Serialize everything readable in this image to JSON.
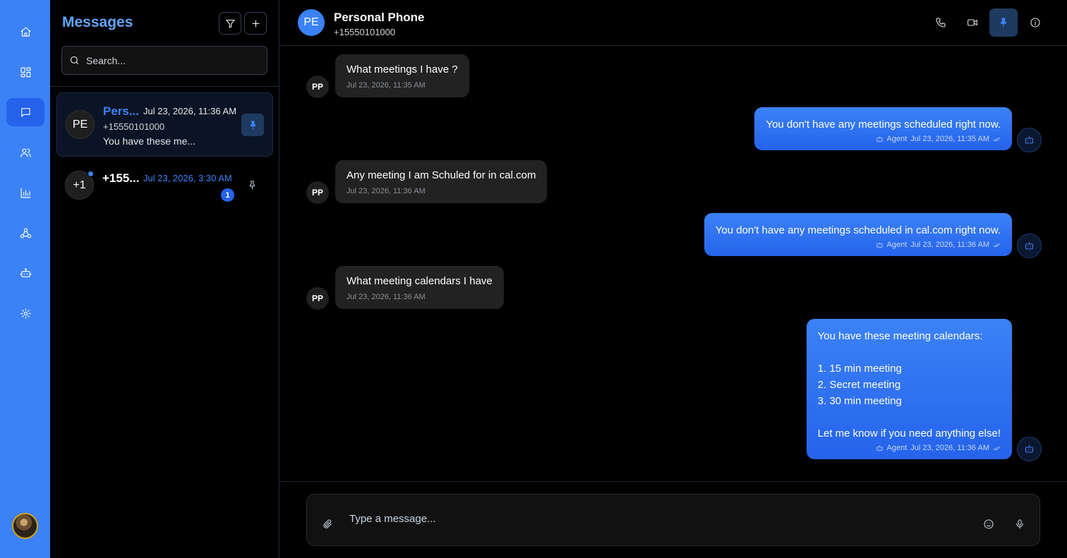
{
  "rail": {
    "items": [
      {
        "name": "home-icon",
        "active": false
      },
      {
        "name": "dashboard-icon",
        "active": false
      },
      {
        "name": "messages-icon",
        "active": true
      },
      {
        "name": "contacts-icon",
        "active": false
      },
      {
        "name": "analytics-icon",
        "active": false
      },
      {
        "name": "webhooks-icon",
        "active": false
      },
      {
        "name": "agents-icon",
        "active": false
      },
      {
        "name": "settings-icon",
        "active": false
      }
    ]
  },
  "list": {
    "title": "Messages",
    "search_placeholder": "Search...",
    "conversations": [
      {
        "avatar": "PE",
        "name": "Pers...",
        "time": "Jul 23, 2026, 11:36 AM",
        "phone": "+15550101000",
        "preview": "You have these me...",
        "pinned": true,
        "active": true
      },
      {
        "avatar": "+1",
        "name": "+155...",
        "time": "Jul 23, 2026, 3:30 AM",
        "unread": "1",
        "pinned": false,
        "active": false
      }
    ]
  },
  "header": {
    "avatar": "PE",
    "name": "Personal Phone",
    "phone": "+15550101000"
  },
  "messages": [
    {
      "dir": "in",
      "avatar": "PP",
      "text": "What meetings I have ?",
      "time": "Jul 23, 2026, 11:35 AM"
    },
    {
      "dir": "out",
      "text": "You don't have any meetings scheduled right now.",
      "sender": "Agent",
      "time": "Jul 23, 2026, 11:35 AM"
    },
    {
      "dir": "in",
      "avatar": "PP",
      "text": "Any meeting I am Schuled for in cal.com",
      "time": "Jul 23, 2026, 11:36 AM"
    },
    {
      "dir": "out",
      "text": "You don't have any meetings scheduled in cal.com right now.",
      "sender": "Agent",
      "time": "Jul 23, 2026, 11:36 AM"
    },
    {
      "dir": "in",
      "avatar": "PP",
      "text": "What meeting calendars I have",
      "time": "Jul 23, 2026, 11:36 AM"
    },
    {
      "dir": "out",
      "text": "You have these meeting calendars:\n\n1. 15 min meeting\n2. Secret meeting\n3. 30 min meeting\n\nLet me know if you need anything else!",
      "sender": "Agent",
      "time": "Jul 23, 2026, 11:36 AM"
    }
  ],
  "composer": {
    "placeholder": "Type a message..."
  },
  "colors": {
    "accent": "#3b82f6",
    "rail": "#3b82f6",
    "bubble_in": "#222222",
    "background": "#000000"
  }
}
